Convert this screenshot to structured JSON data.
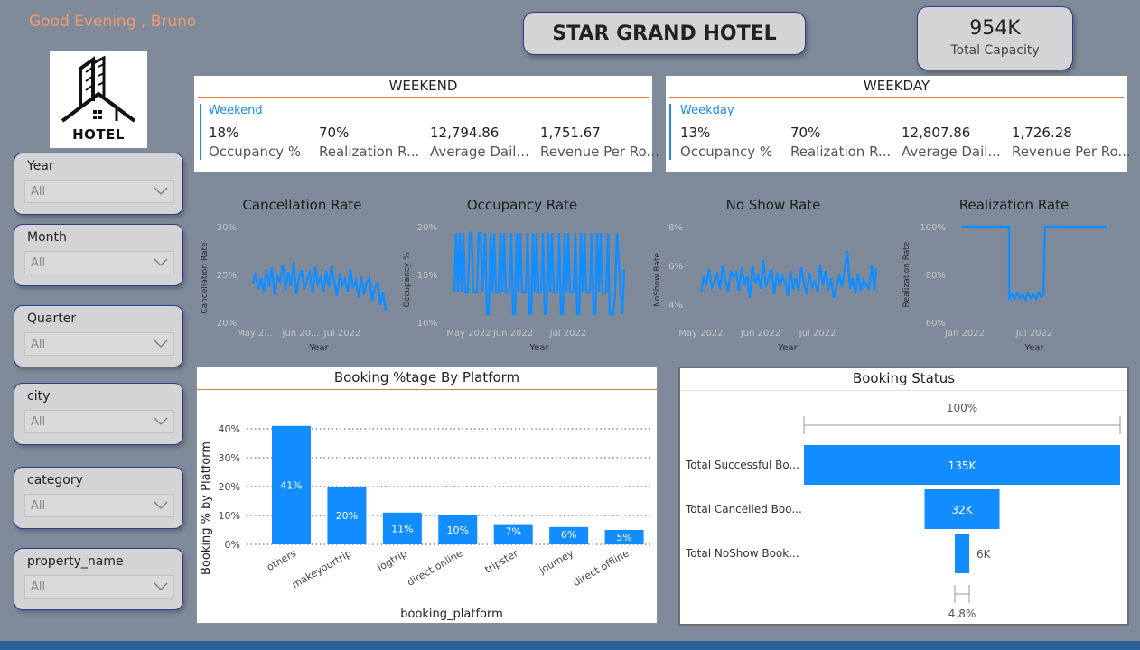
{
  "greeting": "Good Evening  ,  Bruno",
  "logo_text": "HOTEL",
  "title": "STAR GRAND HOTEL",
  "capacity": {
    "value": "954K",
    "label": "Total Capacity"
  },
  "slicers": [
    {
      "label": "Year",
      "value": "All"
    },
    {
      "label": "Month",
      "value": "All"
    },
    {
      "label": "Quarter",
      "value": "All"
    },
    {
      "label": "city",
      "value": "All"
    },
    {
      "label": "category",
      "value": "All"
    },
    {
      "label": "property_name",
      "value": "All"
    }
  ],
  "weekend": {
    "header": "WEEKEND",
    "sub": "Weekend",
    "values": [
      "18%",
      "70%",
      "12,794.86",
      "1,751.67"
    ],
    "labels": [
      "Occupancy %",
      "Realization R...",
      "Average Dail...",
      "Revenue Per Ro..."
    ]
  },
  "weekday": {
    "header": "WEEKDAY",
    "sub": "Weekday",
    "values": [
      "13%",
      "70%",
      "12,807.86",
      "1,726.28"
    ],
    "labels": [
      "Occupancy %",
      "Realization R...",
      "Average Dail...",
      "Revenue Per Ro..."
    ]
  },
  "trend_charts": [
    {
      "title": "Cancellation Rate",
      "ylabel": "Cancellation Rate",
      "xlabel": "Year",
      "yticks": [
        "30%",
        "25%",
        "20%"
      ],
      "xticks": [
        "May 2...",
        "Jun 20...",
        "Jul 2022"
      ]
    },
    {
      "title": "Occupancy Rate",
      "ylabel": "Occupancy %",
      "xlabel": "Year",
      "yticks": [
        "20%",
        "15%",
        "10%"
      ],
      "xticks": [
        "May 2022",
        "Jun 2022",
        "Jul 2022"
      ]
    },
    {
      "title": "No Show Rate",
      "ylabel": "NoShow Rate",
      "xlabel": "Year",
      "yticks": [
        "8%",
        "6%",
        "4%"
      ],
      "xticks": [
        "May 2022",
        "Jun 2022",
        "Jul 2022"
      ]
    },
    {
      "title": "Realization Rate",
      "ylabel": "Realization Rate",
      "xlabel": "Year",
      "yticks": [
        "100%",
        "80%",
        "60%"
      ],
      "xticks": [
        "Jan 2022",
        "Jul 2022"
      ]
    }
  ],
  "platform_panel": {
    "title": "Booking %tage By Platform"
  },
  "status_panel": {
    "title": "Booking Status"
  },
  "chart_data": [
    {
      "type": "bar",
      "title": "Booking %tage By Platform",
      "xlabel": "booking_platform",
      "ylabel": "Booking % by Platform",
      "categories": [
        "others",
        "makeyourtrip",
        "logtrip",
        "direct online",
        "tripster",
        "journey",
        "direct offline"
      ],
      "values": [
        41,
        20,
        11,
        10,
        7,
        6,
        5
      ],
      "data_labels": [
        "41%",
        "20%",
        "11%",
        "10%",
        "7%",
        "6%",
        "5%"
      ],
      "yticks": [
        "40%",
        "30%",
        "20%",
        "10%",
        "0%"
      ],
      "ylim": [
        0,
        45
      ],
      "color": "#118dff"
    },
    {
      "type": "bar",
      "title": "Booking Status",
      "categories": [
        "Total Successful Bo...",
        "Total Cancelled Boo...",
        "Total NoShow Book..."
      ],
      "values": [
        135,
        32,
        6
      ],
      "data_labels": [
        "135K",
        "32K",
        "6K"
      ],
      "top_label": "100%",
      "bottom_label": "4.8%",
      "color": "#118dff"
    }
  ]
}
